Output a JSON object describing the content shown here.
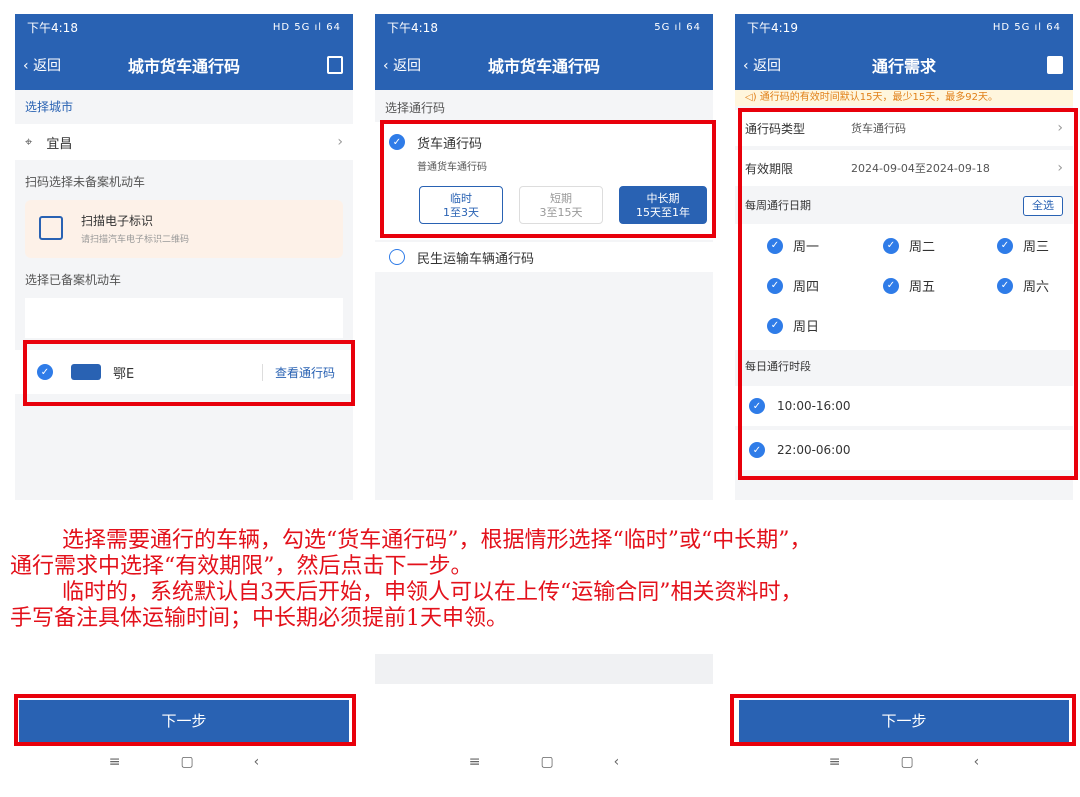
{
  "screens": [
    {
      "time": "下午4:18",
      "signal": "HD 5G ıl 64",
      "back": "返回",
      "title": "城市货车通行码",
      "select_city": "选择城市",
      "city": "宜昌",
      "scan_section": "扫码选择未备案机动车",
      "scan_title": "扫描电子标识",
      "scan_sub": "请扫描汽车电子标识二维码",
      "filed_section": "选择已备案机动车",
      "plate": "鄂E",
      "view_code": "查看通行码"
    },
    {
      "time": "下午4:18",
      "signal": "5G ıl 64",
      "back": "返回",
      "title": "城市货车通行码",
      "select_code": "选择通行码",
      "truck_code": "货车通行码",
      "truck_sub": "普通货车通行码",
      "periods": [
        {
          "name": "临时",
          "range": "1至3天"
        },
        {
          "name": "短期",
          "range": "3至15天"
        },
        {
          "name": "中长期",
          "range": "15天至1年"
        }
      ],
      "civil_code": "民生运输车辆通行码"
    },
    {
      "time": "下午4:19",
      "signal": "HD 5G ıl 64",
      "back": "返回",
      "title": "通行需求",
      "notice": "通行码的有效时间默认15天，最少15天，最多92天。",
      "type_label": "通行码类型",
      "type_value": "货车通行码",
      "validity_label": "有效期限",
      "validity_value": "2024-09-04至2024-09-18",
      "week_label": "每周通行日期",
      "select_all": "全选",
      "days": [
        "周一",
        "周二",
        "周三",
        "周四",
        "周五",
        "周六",
        "周日"
      ],
      "slot_label": "每日通行时段",
      "slots": [
        "10:00-16:00",
        "22:00-06:00"
      ]
    }
  ],
  "annotation": {
    "line1": "选择需要通行的车辆，勾选“货车通行码”，根据情形选择“临时”或“中长期”，",
    "line2": "通行需求中选择“有效期限”，然后点击下一步。",
    "line3": "临时的，系统默认自3天后开始，申领人可以在上传“运输合同”相关资料时，",
    "line4": "手写备注具体运输时间；中长期必须提前1天申领。"
  },
  "next_label": "下一步",
  "sysnav": {
    "menu": "≡",
    "home": "▢",
    "back": "‹"
  },
  "colors": {
    "brand": "#2962b3",
    "check": "#2f7ce8",
    "highlight": "#e8000b"
  }
}
